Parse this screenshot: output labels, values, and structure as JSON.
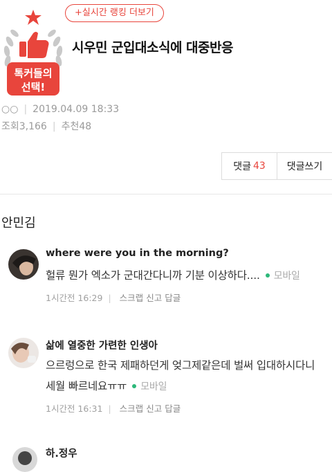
{
  "badge": {
    "text_line1": "톡커들의",
    "text_line2": "선택!"
  },
  "header": {
    "realtime_button": "+실시간 랭킹 더보기",
    "title": "시우민 군입대소식에 대중반응"
  },
  "meta": {
    "author": "○○",
    "date": "2019.04.09 18:33",
    "views_label": "조회3,166",
    "likes_label": "추천48"
  },
  "tabs": {
    "comments_label": "댓글",
    "comments_count": "43",
    "write_label": "댓글쓰기"
  },
  "section_title": "안민김",
  "comments": [
    {
      "nick": "where were you in the morning?",
      "text1": "헐류 뭔가 엑소가 군대간다니까 기분 이상하다....",
      "mobile": "모바일",
      "time": "1시간전 16:29",
      "scrap": "스크랩",
      "report": "신고",
      "reply": "답글"
    },
    {
      "nick": "삶에 열중한 가련한 인생아",
      "text1": "으르렁으로 한국 제패하던게 엊그제같은데 벌써 입대하시다니",
      "text2": "세월 빠르네요ㅠㅠ",
      "mobile": "모바일",
      "time": "1시간전 16:31",
      "scrap": "스크랩",
      "report": "신고",
      "reply": "답글"
    },
    {
      "nick": "하.정우"
    }
  ],
  "colors": {
    "accent": "#e8453c",
    "mobile_dot": "#2db87a"
  },
  "icons": {
    "badge": "thumbs-up-laurel-badge-icon",
    "star": "star-icon"
  }
}
